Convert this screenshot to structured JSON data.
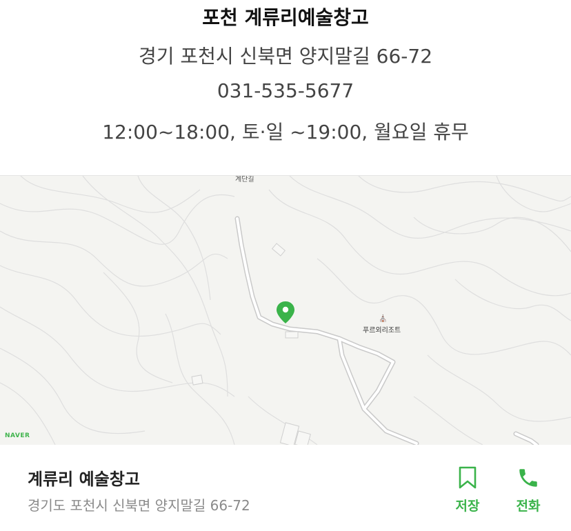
{
  "info": {
    "title": "포천 계류리예술창고",
    "address": "경기 포천시 신북면 양지말길 66-72",
    "phone": "031-535-5677",
    "hours": "12:00~18:00, 토·일 ~19:00, 월요일 휴무"
  },
  "map": {
    "provider_logo": "NAVER",
    "labels": {
      "top_partial": "계단길",
      "resort": "푸르외리조트",
      "resort_icon": "⛪"
    },
    "pin_color": "#3ab34a"
  },
  "bottom_bar": {
    "place_name": "계류리 예술창고",
    "place_address": "경기도 포천시 신북면 양지말길 66-72",
    "save_label": "저장",
    "call_label": "전화",
    "accent": "#3ab34a"
  }
}
